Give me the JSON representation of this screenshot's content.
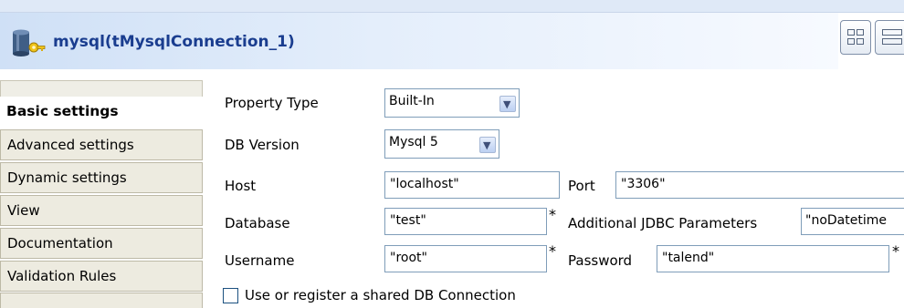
{
  "header": {
    "title": "mysql(tMysqlConnection_1)",
    "icons": [
      "database-key-icon",
      "layout-grid-icon",
      "layout-list-icon"
    ]
  },
  "sidebar": {
    "items": [
      {
        "label": "Basic settings",
        "active": true
      },
      {
        "label": "Advanced settings",
        "active": false
      },
      {
        "label": "Dynamic settings",
        "active": false
      },
      {
        "label": "View",
        "active": false
      },
      {
        "label": "Documentation",
        "active": false
      },
      {
        "label": "Validation Rules",
        "active": false
      }
    ]
  },
  "form": {
    "property_type": {
      "label": "Property Type",
      "value": "Built-In"
    },
    "db_version": {
      "label": "DB Version",
      "value": "Mysql 5"
    },
    "host": {
      "label": "Host",
      "value": "\"localhost\""
    },
    "port": {
      "label": "Port",
      "value": "\"3306\""
    },
    "database": {
      "label": "Database",
      "value": "\"test\""
    },
    "jdbc": {
      "label": "Additional JDBC Parameters",
      "value": "\"noDatetime"
    },
    "username": {
      "label": "Username",
      "value": "\"root\""
    },
    "password": {
      "label": "Password",
      "value": "\"talend\""
    },
    "required_marker": "*",
    "shared_connection": {
      "label": "Use or register a shared DB Connection",
      "checked": false
    }
  },
  "colors": {
    "title_text": "#1a3d8f",
    "sidebar_bg": "#edebe0",
    "field_border": "#7f9db9"
  }
}
